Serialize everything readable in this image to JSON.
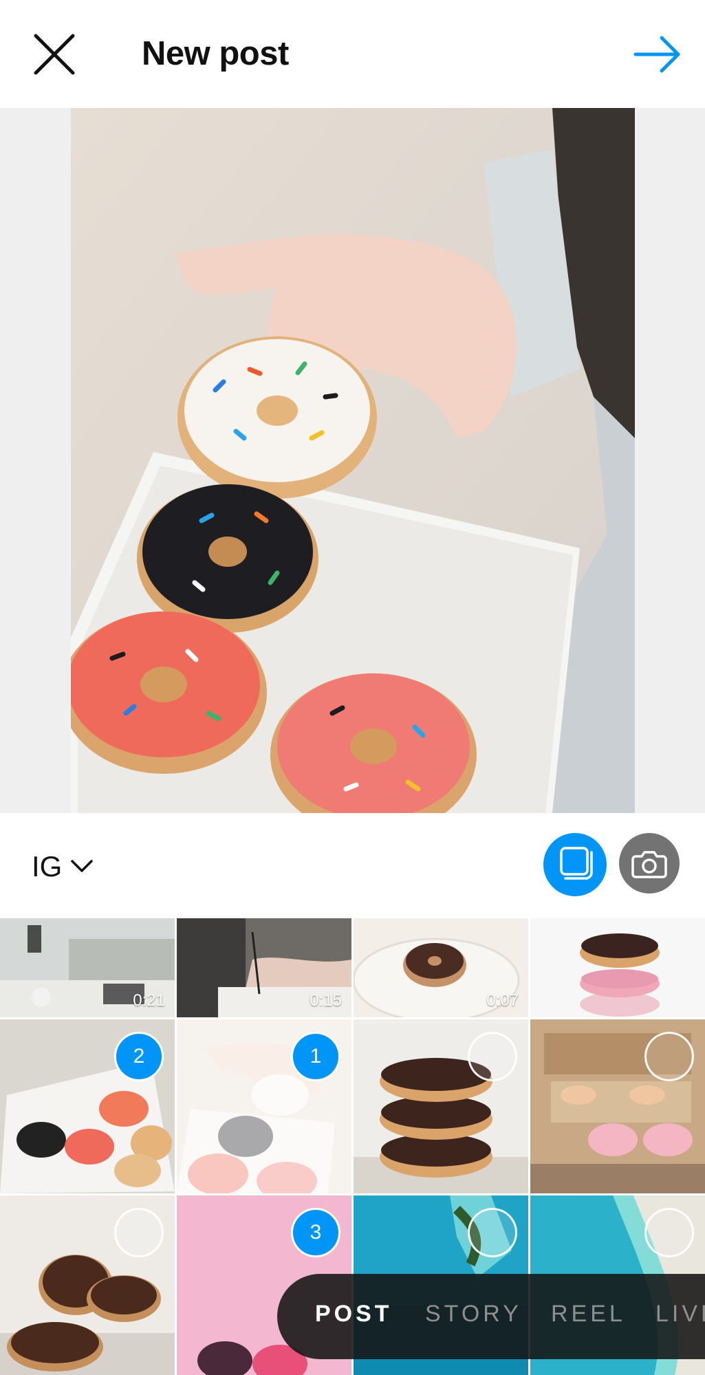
{
  "header": {
    "title": "New post"
  },
  "album": {
    "label": "IG"
  },
  "colors": {
    "accent": "#0095f6",
    "camera_button": "#737373"
  },
  "icons": {
    "close": "close-icon",
    "next": "arrow-right-icon",
    "album_dropdown": "chevron-down-icon",
    "multi_select": "multi-select-icon",
    "camera": "camera-icon"
  },
  "grid": {
    "row1": [
      {
        "duration": "0:21"
      },
      {
        "duration": "0:15"
      },
      {
        "duration": "0:07"
      },
      {
        "duration": ""
      }
    ],
    "row2": [
      {
        "selection": "2"
      },
      {
        "selection": "1"
      },
      {
        "selection": ""
      },
      {
        "selection": ""
      }
    ],
    "row3": [
      {
        "selection": ""
      },
      {
        "selection": "3"
      },
      {
        "selection": ""
      },
      {
        "selection": ""
      }
    ]
  },
  "modes": {
    "post": "POST",
    "story": "STORY",
    "reel": "REEL",
    "live": "LIVE"
  }
}
